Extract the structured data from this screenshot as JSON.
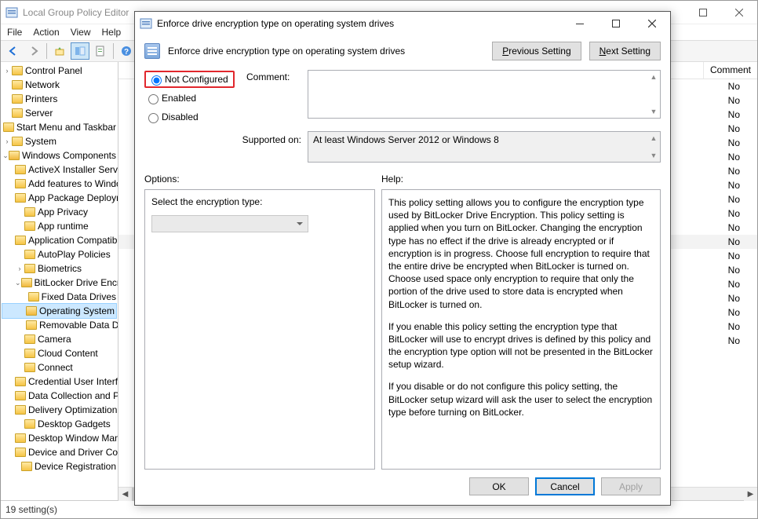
{
  "main_window": {
    "title": "Local Group Policy Editor",
    "menus": [
      "File",
      "Action",
      "View",
      "Help"
    ],
    "status": "19 setting(s)",
    "column_header": "Comment"
  },
  "tree": [
    {
      "label": "Control Panel",
      "indent": 0,
      "exp": "›"
    },
    {
      "label": "Network",
      "indent": 0,
      "exp": ""
    },
    {
      "label": "Printers",
      "indent": 0,
      "exp": ""
    },
    {
      "label": "Server",
      "indent": 0,
      "exp": ""
    },
    {
      "label": "Start Menu and Taskbar",
      "indent": 0,
      "exp": ""
    },
    {
      "label": "System",
      "indent": 0,
      "exp": "›"
    },
    {
      "label": "Windows Components",
      "indent": 0,
      "exp": "⌄",
      "open": true
    },
    {
      "label": "ActiveX Installer Service",
      "indent": 1
    },
    {
      "label": "Add features to Windows",
      "indent": 1
    },
    {
      "label": "App Package Deployment",
      "indent": 1
    },
    {
      "label": "App Privacy",
      "indent": 1
    },
    {
      "label": "App runtime",
      "indent": 1
    },
    {
      "label": "Application Compatibility",
      "indent": 1
    },
    {
      "label": "AutoPlay Policies",
      "indent": 1
    },
    {
      "label": "Biometrics",
      "indent": 1,
      "exp": "›"
    },
    {
      "label": "BitLocker Drive Encryption",
      "indent": 1,
      "exp": "⌄",
      "open": true
    },
    {
      "label": "Fixed Data Drives",
      "indent": 2
    },
    {
      "label": "Operating System Drives",
      "indent": 2,
      "selected": true,
      "open": true
    },
    {
      "label": "Removable Data Drives",
      "indent": 2
    },
    {
      "label": "Camera",
      "indent": 1
    },
    {
      "label": "Cloud Content",
      "indent": 1
    },
    {
      "label": "Connect",
      "indent": 1
    },
    {
      "label": "Credential User Interface",
      "indent": 1
    },
    {
      "label": "Data Collection and Preview Builds",
      "indent": 1
    },
    {
      "label": "Delivery Optimization",
      "indent": 1
    },
    {
      "label": "Desktop Gadgets",
      "indent": 1
    },
    {
      "label": "Desktop Window Manager",
      "indent": 1
    },
    {
      "label": "Device and Driver Compatibility",
      "indent": 1
    },
    {
      "label": "Device Registration",
      "indent": 1
    }
  ],
  "rows": [
    {
      "comment": "No"
    },
    {
      "comment": "No"
    },
    {
      "comment": "No"
    },
    {
      "comment": "No"
    },
    {
      "comment": "No"
    },
    {
      "comment": "No"
    },
    {
      "comment": "No"
    },
    {
      "comment": "No"
    },
    {
      "comment": "No"
    },
    {
      "comment": "No"
    },
    {
      "comment": "No"
    },
    {
      "comment": "No",
      "selected": true
    },
    {
      "comment": "No"
    },
    {
      "comment": "No"
    },
    {
      "comment": "No"
    },
    {
      "comment": "No"
    },
    {
      "comment": "No"
    },
    {
      "comment": "No"
    },
    {
      "comment": "No"
    }
  ],
  "dialog": {
    "title": "Enforce drive encryption type on operating system drives",
    "policy_name": "Enforce drive encryption type on operating system drives",
    "prev": "Previous Setting",
    "next": "Next Setting",
    "next_u": "N",
    "radios": {
      "not_configured": "Not Configured",
      "enabled": "Enabled",
      "disabled": "Disabled"
    },
    "comment_label": "Comment:",
    "supported_label": "Supported on:",
    "supported_text": "At least Windows Server 2012 or Windows 8",
    "options_label": "Options:",
    "help_label": "Help:",
    "option_select_label": "Select the encryption type:",
    "help_p1": "This policy setting allows you to configure the encryption type used by BitLocker Drive Encryption. This policy setting is applied when you turn on BitLocker. Changing the encryption type has no effect if the drive is already encrypted or if encryption is in progress. Choose full encryption to require that the entire drive be encrypted when BitLocker is turned on. Choose used space only encryption to require that only the portion of the drive used to store data is encrypted when BitLocker is turned on.",
    "help_p2": "If you enable this policy setting the encryption type that BitLocker will use to encrypt drives is defined by this policy and the encryption type option will not be presented in the BitLocker setup wizard.",
    "help_p3": "If you disable or do not configure this policy setting, the BitLocker setup wizard will ask the user to select the encryption type before turning on BitLocker.",
    "ok": "OK",
    "cancel": "Cancel",
    "apply": "Apply"
  }
}
